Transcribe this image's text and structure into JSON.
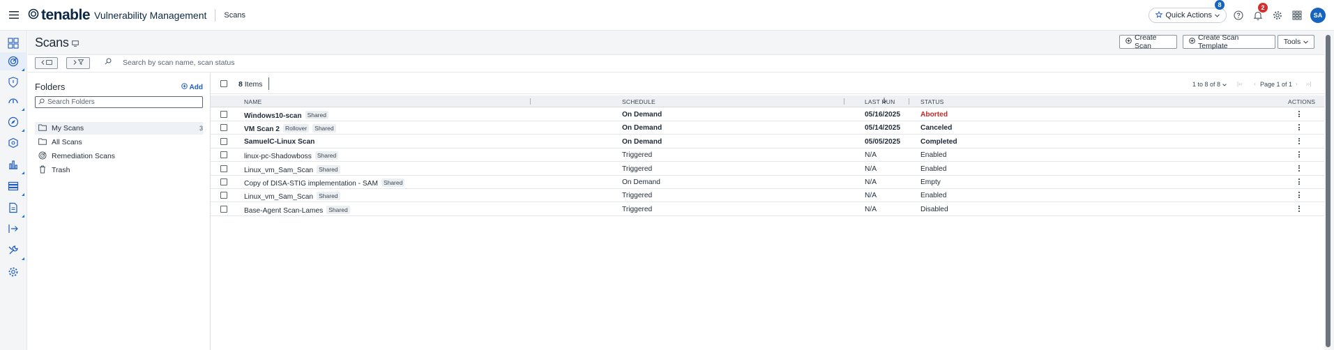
{
  "topbar": {
    "brand_word": "tenable",
    "product": "Vulnerability Management",
    "section": "Scans",
    "quick_actions_label": "Quick Actions",
    "quick_actions_badge": "8",
    "notifications_badge": "2",
    "avatar_initials": "SA"
  },
  "page": {
    "title": "Scans",
    "create_scan_label": "Create Scan",
    "create_template_label": "Create Scan Template",
    "tools_label": "Tools",
    "search_placeholder": "Search by scan name, scan status"
  },
  "folders": {
    "heading": "Folders",
    "add_label": "Add",
    "search_placeholder": "Search Folders",
    "items": [
      {
        "label": "My Scans",
        "count": "3",
        "icon": "folder-icon"
      },
      {
        "label": "All Scans",
        "count": "",
        "icon": "folder-icon"
      },
      {
        "label": "Remediation Scans",
        "count": "",
        "icon": "remediation-icon"
      },
      {
        "label": "Trash",
        "count": "",
        "icon": "trash-icon"
      }
    ]
  },
  "table": {
    "items_count": "8",
    "items_label": "Items",
    "range_label": "1 to 8 of 8",
    "page_label": "Page 1 of 1",
    "columns": {
      "name": "NAME",
      "schedule": "SCHEDULE",
      "last_run": "LAST RUN",
      "status": "STATUS",
      "actions": "ACTIONS"
    },
    "rows": [
      {
        "name": "Windows10-scan",
        "tags": [
          "Shared"
        ],
        "schedule": "On Demand",
        "last_run": "05/16/2025",
        "status": "Aborted",
        "bold": true
      },
      {
        "name": "VM Scan 2",
        "tags": [
          "Rollover",
          "Shared"
        ],
        "schedule": "On Demand",
        "last_run": "05/14/2025",
        "status": "Canceled",
        "bold": true
      },
      {
        "name": "SamuelC-Linux Scan",
        "tags": [],
        "schedule": "On Demand",
        "last_run": "05/05/2025",
        "status": "Completed",
        "bold": true
      },
      {
        "name": "linux-pc-Shadowboss",
        "tags": [
          "Shared"
        ],
        "schedule": "Triggered",
        "last_run": "N/A",
        "status": "Enabled",
        "bold": false
      },
      {
        "name": "Linux_vm_Sam_Scan",
        "tags": [
          "Shared"
        ],
        "schedule": "Triggered",
        "last_run": "N/A",
        "status": "Enabled",
        "bold": false
      },
      {
        "name": "Copy of DISA-STIG implementation - SAM",
        "tags": [
          "Shared"
        ],
        "schedule": "On Demand",
        "last_run": "N/A",
        "status": "Empty",
        "bold": false
      },
      {
        "name": "Linux_vm_Sam_Scan",
        "tags": [
          "Shared"
        ],
        "schedule": "Triggered",
        "last_run": "N/A",
        "status": "Enabled",
        "bold": false
      },
      {
        "name": "Base-Agent Scan-Lames",
        "tags": [
          "Shared"
        ],
        "schedule": "Triggered",
        "last_run": "N/A",
        "status": "Disabled",
        "bold": false
      }
    ]
  },
  "colors": {
    "accent": "#1e5bbd",
    "aborted": "#c62828",
    "badge_blue": "#1565c0",
    "badge_red": "#d32f2f"
  }
}
